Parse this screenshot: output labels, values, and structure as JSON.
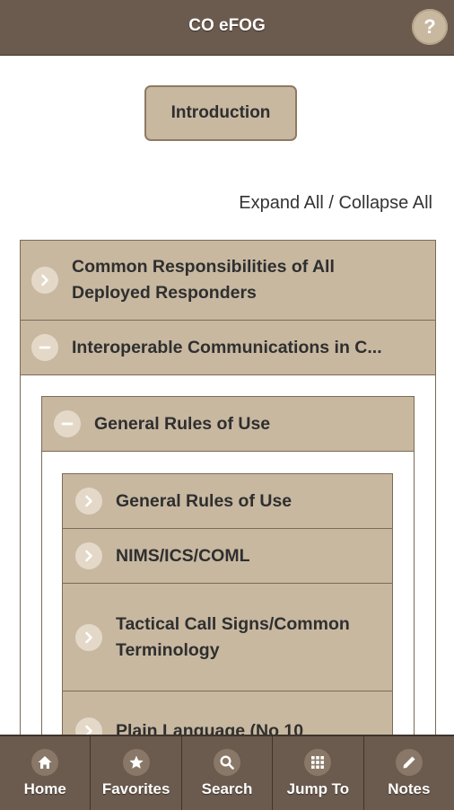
{
  "header": {
    "title": "CO eFOG",
    "help_label": "?"
  },
  "intro_button": "Introduction",
  "expand_all": "Expand All",
  "separator": " / ",
  "collapse_all": "Collapse All",
  "sections": [
    {
      "label": "Common Responsibilities of All Deployed Responders",
      "state": "collapsed"
    },
    {
      "label": "Interoperable Communications in C...",
      "state": "expanded"
    }
  ],
  "subsection": {
    "label": "General Rules of Use",
    "state": "expanded"
  },
  "items": [
    {
      "label": "General Rules of Use"
    },
    {
      "label": "NIMS/ICS/COML"
    },
    {
      "label": "Tactical Call Signs/Common Terminology"
    },
    {
      "label": "Plain Language (No 10"
    }
  ],
  "nav": [
    {
      "label": "Home",
      "icon": "home-icon"
    },
    {
      "label": "Favorites",
      "icon": "star-icon"
    },
    {
      "label": "Search",
      "icon": "search-icon"
    },
    {
      "label": "Jump To",
      "icon": "grid-icon"
    },
    {
      "label": "Notes",
      "icon": "pencil-icon"
    }
  ],
  "colors": {
    "header": "#6b5a4e",
    "tile": "#c8b8a0",
    "border": "#7c6a56",
    "text": "#2f2f2f"
  }
}
